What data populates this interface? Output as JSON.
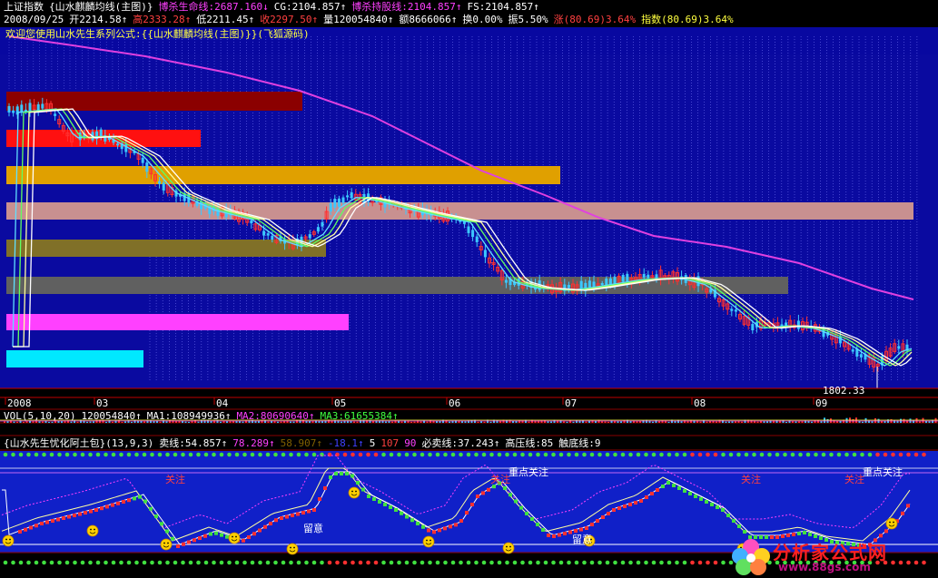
{
  "colors": {
    "bg": "#000000",
    "price_panel": "#0a0aa0",
    "osc_panel": "#1020c8",
    "yang": "#ff3030",
    "yin": "#3cc8ff",
    "ma_long": "#e040e0"
  },
  "header": {
    "line1": [
      {
        "text": "上证指数",
        "color": "#ffffff"
      },
      {
        "text": "{山水麒麟均线(主图)}",
        "color": "#ffffff"
      },
      {
        "text": "博杀生命线:2687.160↓",
        "color": "#ff40ff"
      },
      {
        "text": "CG:2104.857↑",
        "color": "#ffffff"
      },
      {
        "text": "博杀持股线:2104.857↑",
        "color": "#ff40ff"
      },
      {
        "text": "FS:2104.857↑",
        "color": "#ffffff"
      }
    ],
    "line2": [
      {
        "text": "2008/09/25",
        "color": "#ffffff"
      },
      {
        "text": "开2214.58↑",
        "color": "#ffffff"
      },
      {
        "text": "高2333.28↑",
        "color": "#ff4040"
      },
      {
        "text": "低2211.45↑",
        "color": "#ffffff"
      },
      {
        "text": "收2297.50↑",
        "color": "#ff4040"
      },
      {
        "text": "量120054840↑",
        "color": "#ffffff"
      },
      {
        "text": "额8666066↑",
        "color": "#ffffff"
      },
      {
        "text": "换0.00%",
        "color": "#ffffff"
      },
      {
        "text": "振5.50%",
        "color": "#ffffff"
      },
      {
        "text": "涨(80.69)3.64%",
        "color": "#ff4040"
      },
      {
        "text": "指数(80.69)3.64%",
        "color": "#ffff40"
      }
    ],
    "welcome": "欢迎您使用山水先生系列公式:{{山水麒麟均线(主图)}}(飞狐源码)"
  },
  "price_chart": {
    "low_label": "1802.33",
    "x_axis_labels": [
      "2008",
      "03",
      "04",
      "05",
      "06",
      "07",
      "08",
      "09"
    ],
    "band_colors": [
      "#8b0000",
      "#ff1010",
      "#e0a000",
      "#c89090",
      "#807028",
      "#606060",
      "#ff40ff",
      "#00e8ff"
    ]
  },
  "volume": {
    "labels": [
      {
        "text": "VOL(5,10,20)",
        "color": "#ffffff"
      },
      {
        "text": "120054840↑",
        "color": "#ffffff"
      },
      {
        "text": "MA1:108949936↑",
        "color": "#ffffff"
      },
      {
        "text": "MA2:80690640↑",
        "color": "#ff40ff"
      },
      {
        "text": "MA3:61655384↑",
        "color": "#40ff40"
      }
    ]
  },
  "indicator": {
    "labels": [
      {
        "text": "{山水先生忧化阿土包}(13,9,3)",
        "color": "#ffffff"
      },
      {
        "text": "卖线:54.857↑",
        "color": "#ffffff"
      },
      {
        "text": "78.289↑",
        "color": "#ff40ff"
      },
      {
        "text": "58.907↑",
        "color": "#806000"
      },
      {
        "text": "-18.1↑",
        "color": "#4040ff"
      },
      {
        "text": "5",
        "color": "#ffffff"
      },
      {
        "text": "107",
        "color": "#ff4040"
      },
      {
        "text": "90",
        "color": "#ff40ff"
      },
      {
        "text": "必卖线:37.243↑",
        "color": "#ffffff"
      },
      {
        "text": "高压线:85",
        "color": "#ffffff"
      },
      {
        "text": "触底线:9",
        "color": "#ffffff"
      }
    ],
    "annotations": [
      "关注",
      "关注",
      "重点关注",
      "关注",
      "关注",
      "重点关注",
      "留意",
      "留意"
    ]
  },
  "watermark": {
    "title": "分析家公式网",
    "url": "www.88gs.com"
  },
  "chart_data": {
    "type": "candlestick",
    "title": "上证指数",
    "date": "2008/09/25",
    "open": 2214.58,
    "high": 2333.28,
    "low": 2211.45,
    "close": 2297.5,
    "volume": 120054840,
    "amount": 8666066,
    "turnover_pct": 0.0,
    "amplitude_pct": 5.5,
    "change": 80.69,
    "change_pct": 3.64,
    "x_axis_labels": [
      "2008",
      "03",
      "04",
      "05",
      "06",
      "07",
      "08",
      "09"
    ],
    "visible_low": 1802.33,
    "indicators": {
      "博杀生命线": 2687.16,
      "CG": 2104.857,
      "博杀持股线": 2104.857,
      "FS": 2104.857,
      "VOL_MA1": 108949936,
      "VOL_MA2": 80690640,
      "VOL_MA3": 61655384,
      "卖线": 54.857,
      "必卖线": 37.243,
      "高压线": 85,
      "触底线": 9
    },
    "close_path_approx": [
      5340,
      5420,
      5300,
      5050,
      4850,
      4550,
      4450,
      4100,
      3820,
      3600,
      3550,
      3700,
      3500,
      3620,
      3560,
      3720,
      3480,
      3300,
      3350,
      3600,
      3000,
      2950,
      2800,
      2830,
      2700,
      2750,
      2450,
      2250,
      2100,
      2000,
      1960,
      2040,
      1840,
      2297
    ]
  }
}
